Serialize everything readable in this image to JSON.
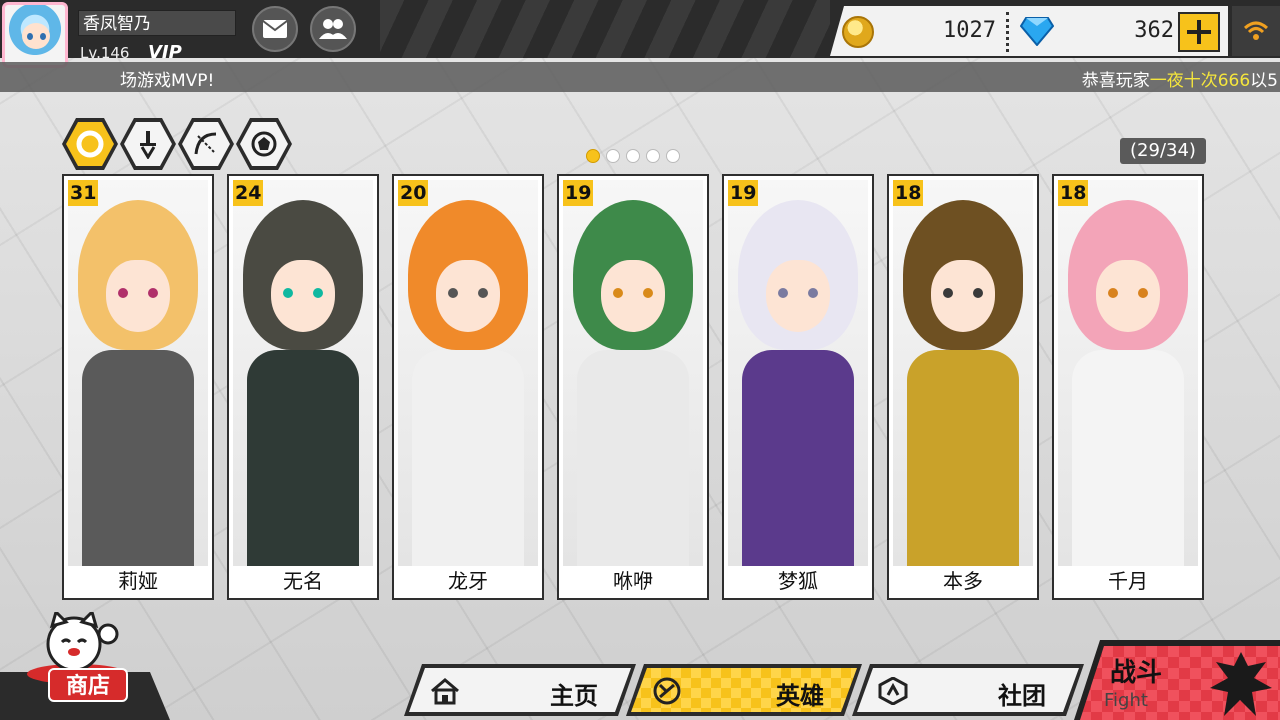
{
  "player": {
    "name": "香凤智乃",
    "level": "Lv.146",
    "vip": "VIP"
  },
  "resources": {
    "gold": "1027",
    "gems": "362"
  },
  "marquee": {
    "left": "场游戏MVP!",
    "right_prefix": "恭喜玩家",
    "right_highlight": "一夜十次666",
    "right_suffix": "以5"
  },
  "filters": [
    {
      "icon": "all-ring-icon",
      "active": true
    },
    {
      "icon": "sword-icon",
      "active": false
    },
    {
      "icon": "bow-icon",
      "active": false
    },
    {
      "icon": "support-icon",
      "active": false
    }
  ],
  "pagination": {
    "pages": 5,
    "current": 0,
    "count": "(29/34)"
  },
  "heroes": [
    {
      "name": "莉娅",
      "level": "31",
      "hair": "#f3c16a",
      "body": "#5a5a5a",
      "eye": "#b0306a"
    },
    {
      "name": "无名",
      "level": "24",
      "hair": "#4a4a42",
      "body": "#2f3a36",
      "eye": "#0fb8a0"
    },
    {
      "name": "龙牙",
      "level": "20",
      "hair": "#f08a2a",
      "body": "#f0f0f0",
      "eye": "#555555"
    },
    {
      "name": "咻咿",
      "level": "19",
      "hair": "#3e8a4a",
      "body": "#e9e9e9",
      "eye": "#d98a1a"
    },
    {
      "name": "梦狐",
      "level": "19",
      "hair": "#e8e6f2",
      "body": "#5b3a8c",
      "eye": "#7a7aa0"
    },
    {
      "name": "本多",
      "level": "18",
      "hair": "#6e5022",
      "body": "#c9a22a",
      "eye": "#3a3a3a"
    },
    {
      "name": "千月",
      "level": "18",
      "hair": "#f3a4b8",
      "body": "#f4f4f4",
      "eye": "#d8821e"
    }
  ],
  "shop": {
    "label": "商店"
  },
  "nav": [
    {
      "label": "主页",
      "icon": "home-icon",
      "active": false
    },
    {
      "label": "英雄",
      "icon": "hero-icon",
      "active": true
    },
    {
      "label": "社团",
      "icon": "guild-icon",
      "active": false
    }
  ],
  "fight": {
    "label_cn": "战斗",
    "label_en": "Fight"
  },
  "colors": {
    "accent": "#f7c21b",
    "dark": "#2b2b2b",
    "fight": "#e23a46"
  }
}
